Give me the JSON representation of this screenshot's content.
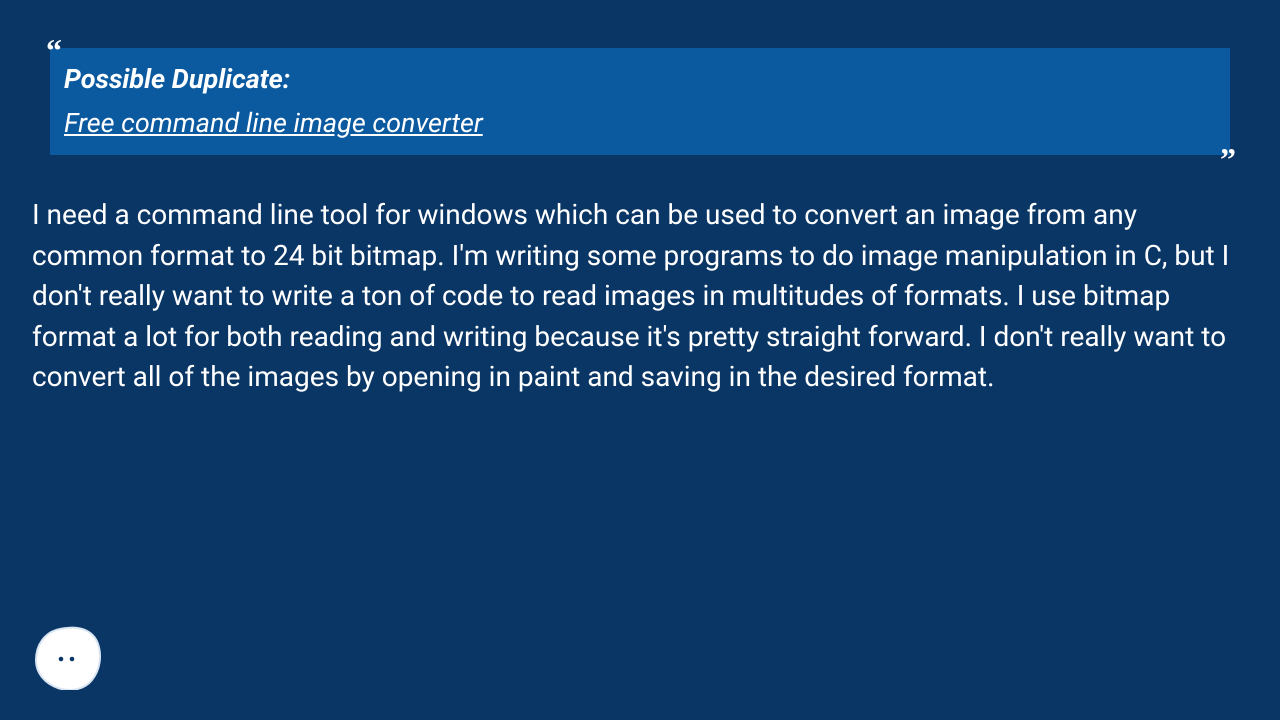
{
  "duplicate": {
    "heading": "Possible Duplicate:",
    "link_text": "Free command line image converter"
  },
  "body": "I need a command line tool for windows which can be used to convert an image from any common format to 24 bit bitmap. I'm writing some programs to do image manipulation in C, but I don't really want to write a ton of code to read images in multitudes of formats. I use bitmap format a lot for both reading and writing because it's pretty straight forward. I don't really want to convert all of the images by opening in paint and saving in the desired format."
}
